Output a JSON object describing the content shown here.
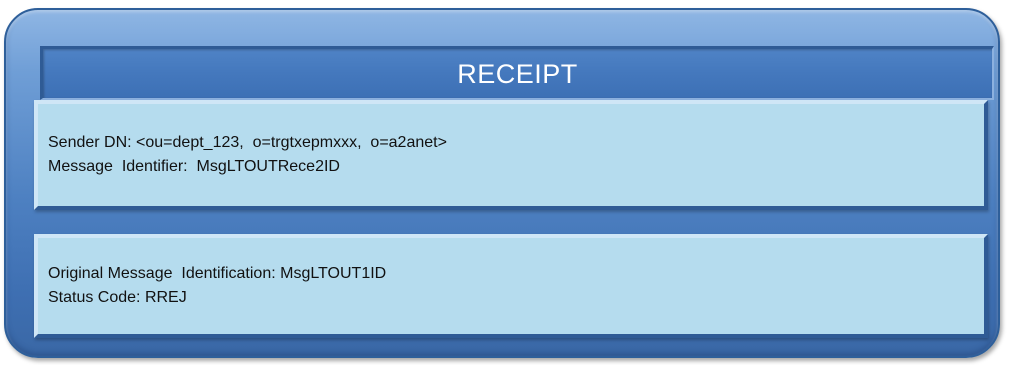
{
  "header": {
    "title": "RECEIPT"
  },
  "panels": [
    {
      "lines": [
        "Sender DN: <ou=dept_123,  o=trgtxepmxxx,  o=a2anet>",
        "Message  Identifier:  MsgLTOUTRece2ID"
      ]
    },
    {
      "lines": [
        "Original Message  Identification: MsgLTOUT1ID",
        "Status Code: RREJ"
      ]
    }
  ],
  "colors": {
    "outer_frame": "#4d80c1",
    "header_bar": "#4478bd",
    "panel_fill": "#b5dcee",
    "text": "#111111"
  }
}
